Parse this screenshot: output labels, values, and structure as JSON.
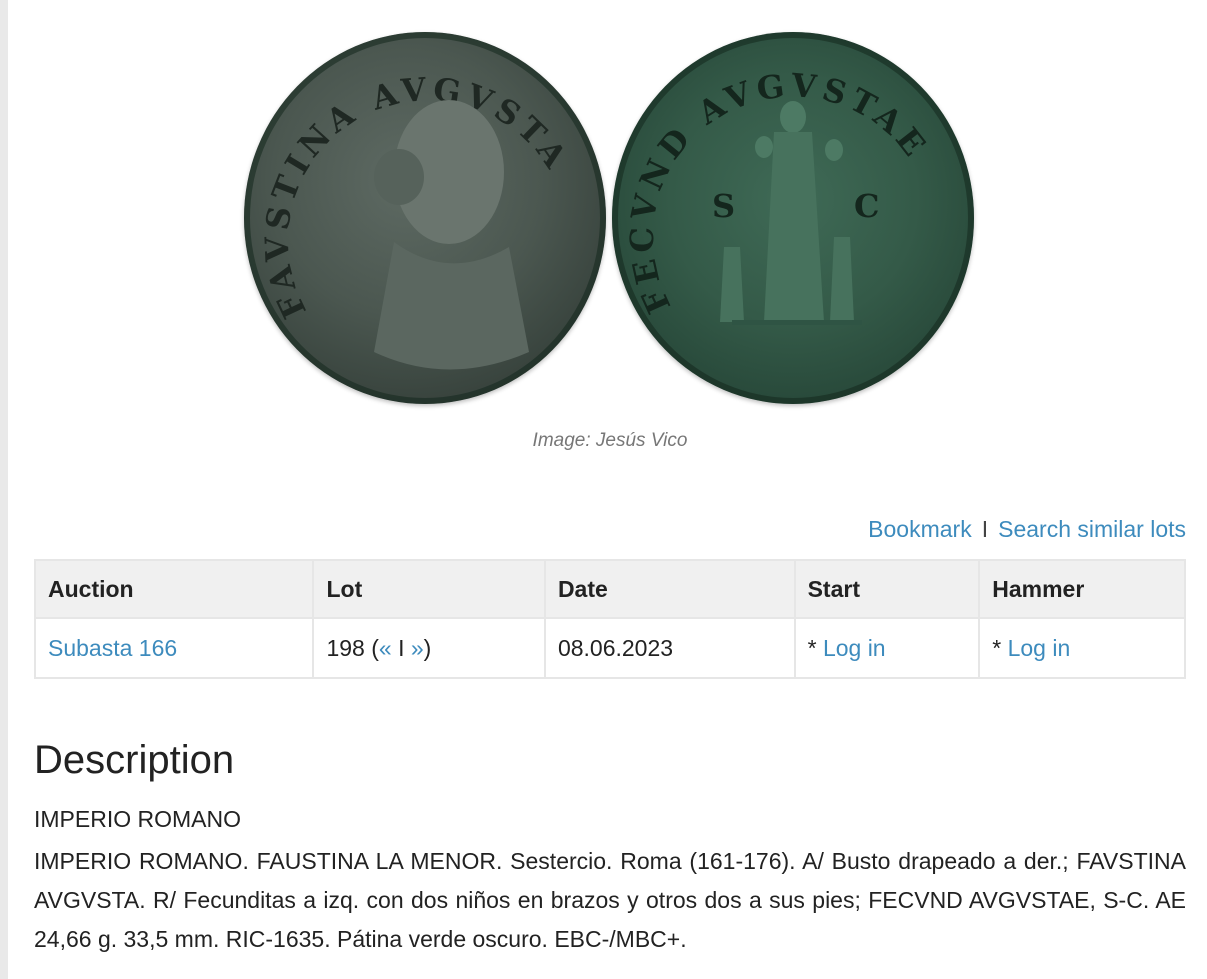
{
  "images": {
    "obverse_legend": "FAVSTINA AVGVSTA",
    "reverse_legend": "FECVND AVGVSTAE",
    "reverse_left_field": "S",
    "reverse_right_field": "C",
    "caption": "Image: Jesús Vico"
  },
  "actions": {
    "bookmark_label": "Bookmark",
    "separator": "I",
    "search_similar_label": "Search similar lots"
  },
  "table": {
    "headers": [
      "Auction",
      "Lot",
      "Date",
      "Start",
      "Hammer"
    ],
    "row": {
      "auction": "Subasta 166",
      "lot_number": "198 (",
      "lot_prev": "«",
      "lot_sep": " I ",
      "lot_next": "»",
      "lot_close": ")",
      "date": "08.06.2023",
      "start_prefix": "* ",
      "start_link": "Log in",
      "hammer_prefix": "* ",
      "hammer_link": "Log in"
    }
  },
  "description": {
    "title": "Description",
    "category": "IMPERIO ROMANO",
    "text": "IMPERIO ROMANO. FAUSTINA LA MENOR. Sestercio. Roma (161-176). A/ Busto drapeado a der.; FAVSTINA AVGVSTA. R/ Fecunditas a izq. con dos niños en brazos y otros dos a sus pies; FECVND AVGVSTAE, S-C. AE 24,66 g. 33,5 mm. RIC-1635. Pátina verde oscuro. EBC-/MBC+."
  },
  "colors": {
    "link": "#3d8bbd",
    "header_bg": "#f0f0f0",
    "obverse_patina": "#4b5750",
    "reverse_patina": "#345a48"
  }
}
